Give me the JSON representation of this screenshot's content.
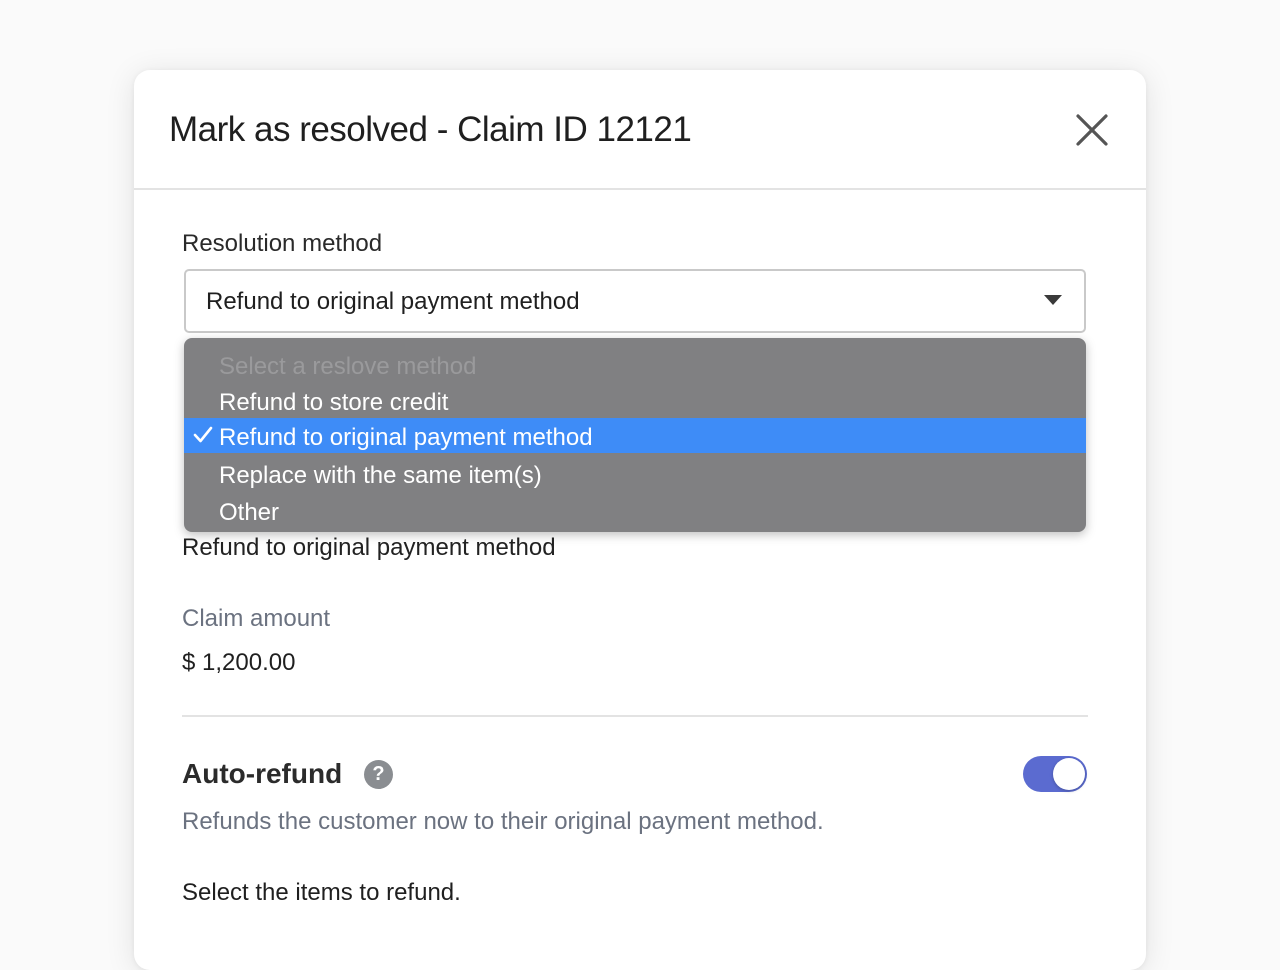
{
  "modal": {
    "title": "Mark as resolved - Claim ID 12121",
    "close_icon": "close-icon"
  },
  "resolution": {
    "label": "Resolution method",
    "selected_value": "Refund to original payment method",
    "under_text": "Refund to original payment method",
    "options": [
      {
        "label": "Select a reslove method",
        "placeholder": true
      },
      {
        "label": "Refund to store credit"
      },
      {
        "label": "Refund to original payment method",
        "selected": true
      },
      {
        "label": "Replace with the same item(s)"
      },
      {
        "label": "Other"
      }
    ]
  },
  "claim": {
    "label": "Claim amount",
    "value": "$ 1,200.00"
  },
  "auto_refund": {
    "title": "Auto-refund",
    "help_glyph": "?",
    "enabled": true,
    "description": "Refunds the customer now to their original payment method."
  },
  "items": {
    "prompt": "Select the items to refund."
  },
  "colors": {
    "accent_toggle": "#5b6bd0",
    "selected_option": "#3e8cf7",
    "menu_background": "#808082"
  }
}
